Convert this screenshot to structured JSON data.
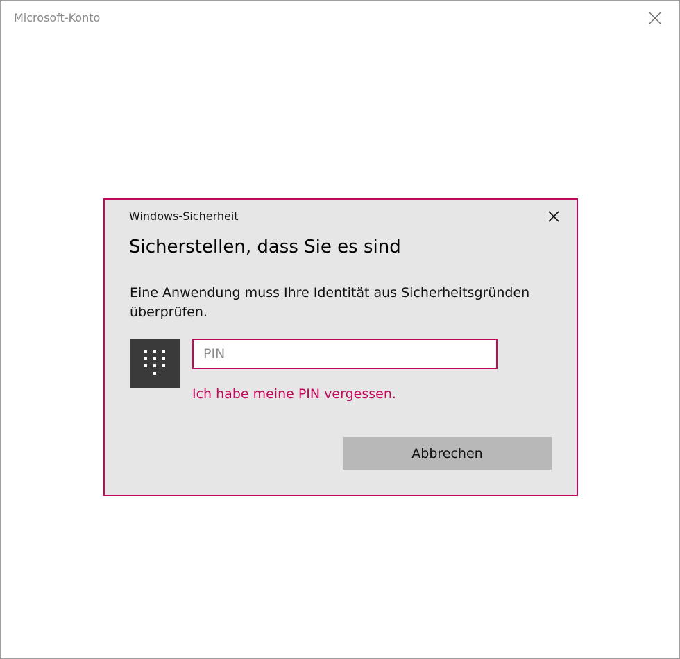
{
  "window": {
    "title": "Microsoft-Konto",
    "close_icon": "close-icon"
  },
  "dialog": {
    "caption": "Windows-Sicherheit",
    "heading": "Sicherstellen, dass Sie es sind",
    "message": "Eine Anwendung muss Ihre Identität aus Sicherheitsgründen überprüfen.",
    "pin_icon": "keypad-icon",
    "pin_placeholder": "PIN",
    "pin_value": "",
    "forgot_link": "Ich habe meine PIN vergessen.",
    "cancel_label": "Abbrechen",
    "close_icon": "close-icon"
  },
  "colors": {
    "accent": "#c1085a",
    "dialog_background": "#e6e6e6",
    "button_background": "#b8b8b8",
    "tile_background": "#3a3a3a"
  }
}
